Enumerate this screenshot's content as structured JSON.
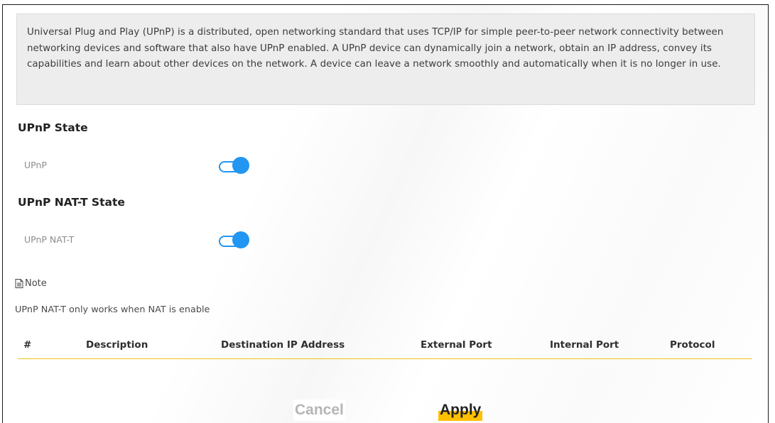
{
  "intro": {
    "text": "Universal Plug and Play (UPnP) is a distributed, open networking standard that uses TCP/IP for simple peer-to-peer network connectivity between networking devices and software that also have UPnP enabled. A UPnP device can dynamically join a network, obtain an IP address, convey its capabilities and learn about other devices on the network. A device can leave a network smoothly and automatically when it is no longer in use."
  },
  "upnp_state": {
    "title": "UPnP State",
    "label": "UPnP",
    "enabled": true
  },
  "nat_t_state": {
    "title": "UPnP NAT-T State",
    "label": "UPnP NAT-T",
    "enabled": true
  },
  "note": {
    "icon": "document-icon",
    "title": "Note",
    "text": "UPnP NAT-T only works when NAT is enable"
  },
  "table": {
    "headers": [
      "#",
      "Description",
      "Destination IP Address",
      "External Port",
      "Internal Port",
      "Protocol"
    ],
    "rows": []
  },
  "buttons": {
    "cancel": "Cancel",
    "apply": "Apply"
  },
  "colors": {
    "toggle_on": "#2196f3",
    "accent": "#ffc000",
    "table_rule": "#f0c419"
  }
}
